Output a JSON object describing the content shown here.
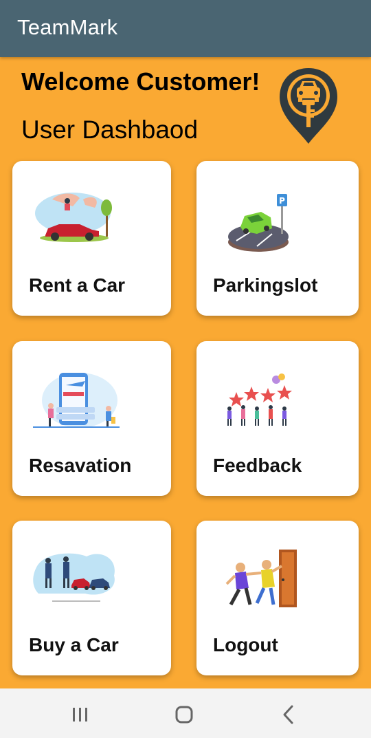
{
  "app": {
    "title": "TeamMark"
  },
  "header": {
    "welcome": "Welcome Customer!",
    "subtitle": "User Dashbaod"
  },
  "cards": [
    {
      "label": "Rent a Car",
      "icon": "rent-car-illustration"
    },
    {
      "label": "Parkingslot",
      "icon": "parking-slot-illustration"
    },
    {
      "label": "Resavation",
      "icon": "reservation-illustration"
    },
    {
      "label": "Feedback",
      "icon": "feedback-illustration"
    },
    {
      "label": "Buy a Car",
      "icon": "buy-car-illustration"
    },
    {
      "label": "Logout",
      "icon": "logout-illustration"
    }
  ],
  "colors": {
    "background": "#FAA933",
    "appbar": "#4A6572",
    "card": "#FFFFFF",
    "navbar": "#F3F3F3"
  },
  "navbar": {
    "buttons": [
      "recent-apps-icon",
      "home-icon",
      "back-icon"
    ]
  }
}
